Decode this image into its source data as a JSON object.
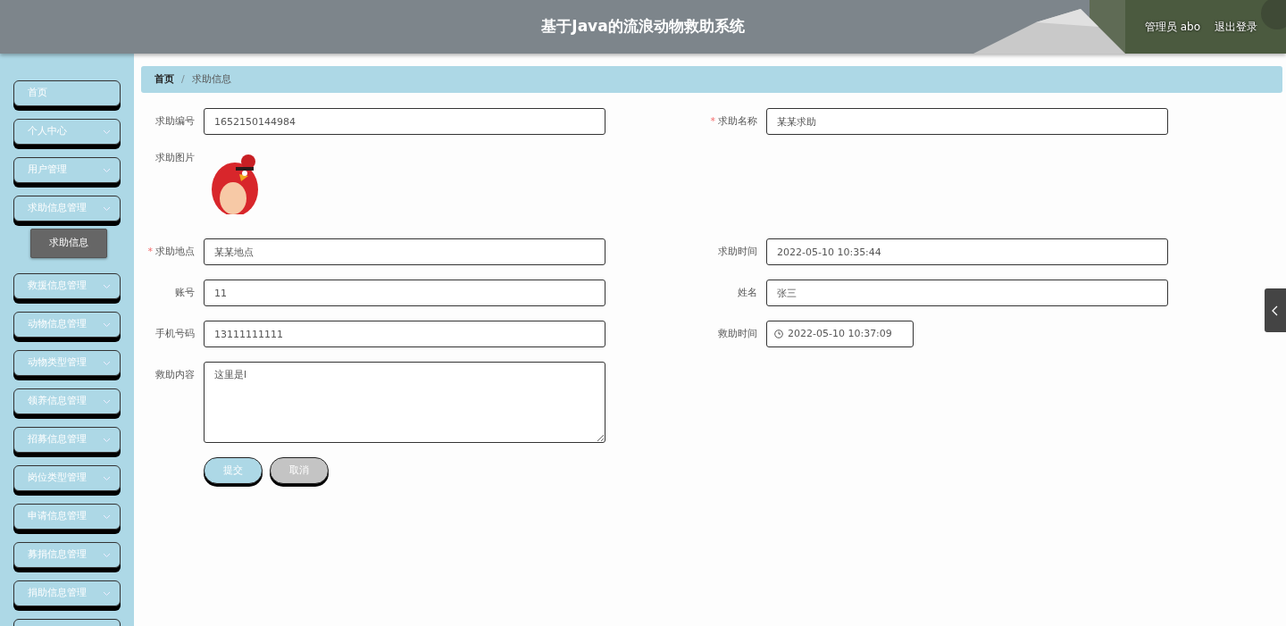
{
  "header": {
    "title": "基于Java的流浪动物救助系统",
    "user": "管理员 abo",
    "logout": "退出登录"
  },
  "sidebar": {
    "items": [
      {
        "label": "首页",
        "expandable": false
      },
      {
        "label": "个人中心",
        "expandable": true
      },
      {
        "label": "用户管理",
        "expandable": true
      },
      {
        "label": "求助信息管理",
        "expandable": true,
        "children": [
          {
            "label": "求助信息",
            "selected": true
          }
        ]
      },
      {
        "label": "救援信息管理",
        "expandable": true
      },
      {
        "label": "动物信息管理",
        "expandable": true
      },
      {
        "label": "动物类型管理",
        "expandable": true
      },
      {
        "label": "领养信息管理",
        "expandable": true
      },
      {
        "label": "招募信息管理",
        "expandable": true
      },
      {
        "label": "岗位类型管理",
        "expandable": true
      },
      {
        "label": "申请信息管理",
        "expandable": true
      },
      {
        "label": "募捐信息管理",
        "expandable": true
      },
      {
        "label": "捐助信息管理",
        "expandable": true
      },
      {
        "kind": "cut"
      }
    ]
  },
  "breadcrumb": {
    "separator": "/",
    "items": [
      {
        "label": "首页",
        "current": false
      },
      {
        "label": "求助信息",
        "current": true
      }
    ]
  },
  "form": {
    "rows": [
      [
        {
          "kind": "text",
          "label": "求助编号",
          "value": "1652150144984"
        },
        {
          "kind": "text",
          "required_mark": "*",
          "label": "求助名称",
          "value": "某某求助"
        }
      ],
      [
        {
          "label": "求助图片"
        }
      ],
      [
        {
          "kind": "text",
          "required_mark": "*",
          "label": "求助地点",
          "value": "某某地点"
        },
        {
          "kind": "text",
          "label": "求助时间",
          "value": "2022-05-10 10:35:44"
        }
      ],
      [
        {
          "kind": "text",
          "label": "账号",
          "value": "11"
        },
        {
          "kind": "text",
          "label": "姓名",
          "value": "张三"
        }
      ],
      [
        {
          "kind": "text",
          "label": "手机号码",
          "value": "13111111111"
        },
        {
          "kind": "datetime",
          "label": "救助时间",
          "value": "2022-05-10 10:37:09"
        }
      ],
      [
        {
          "kind": "textarea",
          "label": "救助内容",
          "value": "这里是l"
        }
      ]
    ],
    "buttons": [
      {
        "label": "提交",
        "kind": "primary"
      },
      {
        "label": "取消",
        "kind": "secondary"
      }
    ]
  }
}
